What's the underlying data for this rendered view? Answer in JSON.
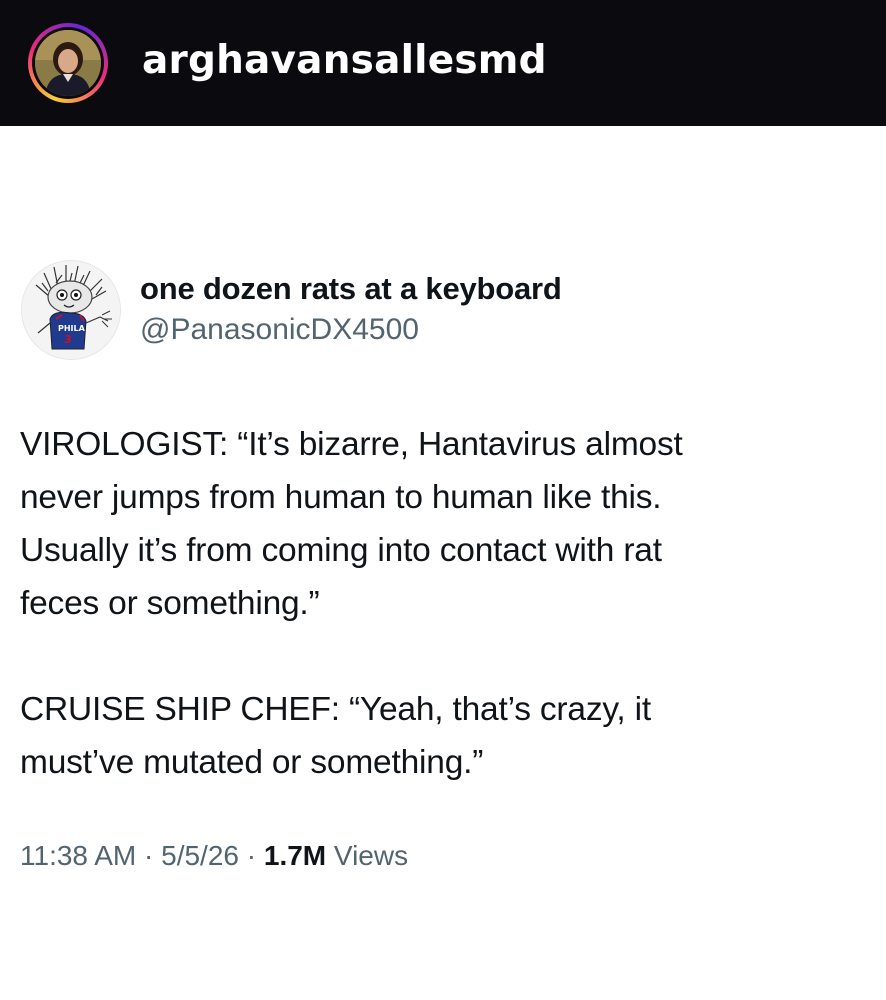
{
  "instagram_header": {
    "username": "arghavansallesmd"
  },
  "tweet": {
    "display_name": "one dozen rats at a keyboard",
    "handle": "@PanasonicDX4500",
    "paragraphs": [
      "VIROLOGIST: “It’s bizarre, Hantavirus almost\nnever jumps from human to human like this.\nUsually it’s from coming into contact with rat\nfeces or something.”",
      "CRUISE SHIP CHEF: “Yeah, that’s crazy, it\nmust’ve mutated or something.”"
    ],
    "time": "11:38 AM",
    "separator": "·",
    "date": "5/5/26",
    "views_count": "1.7M",
    "views_label": "Views"
  },
  "colors": {
    "header_bg": "#0a0a0f",
    "text_primary": "#0f1419",
    "text_secondary": "#536471"
  }
}
